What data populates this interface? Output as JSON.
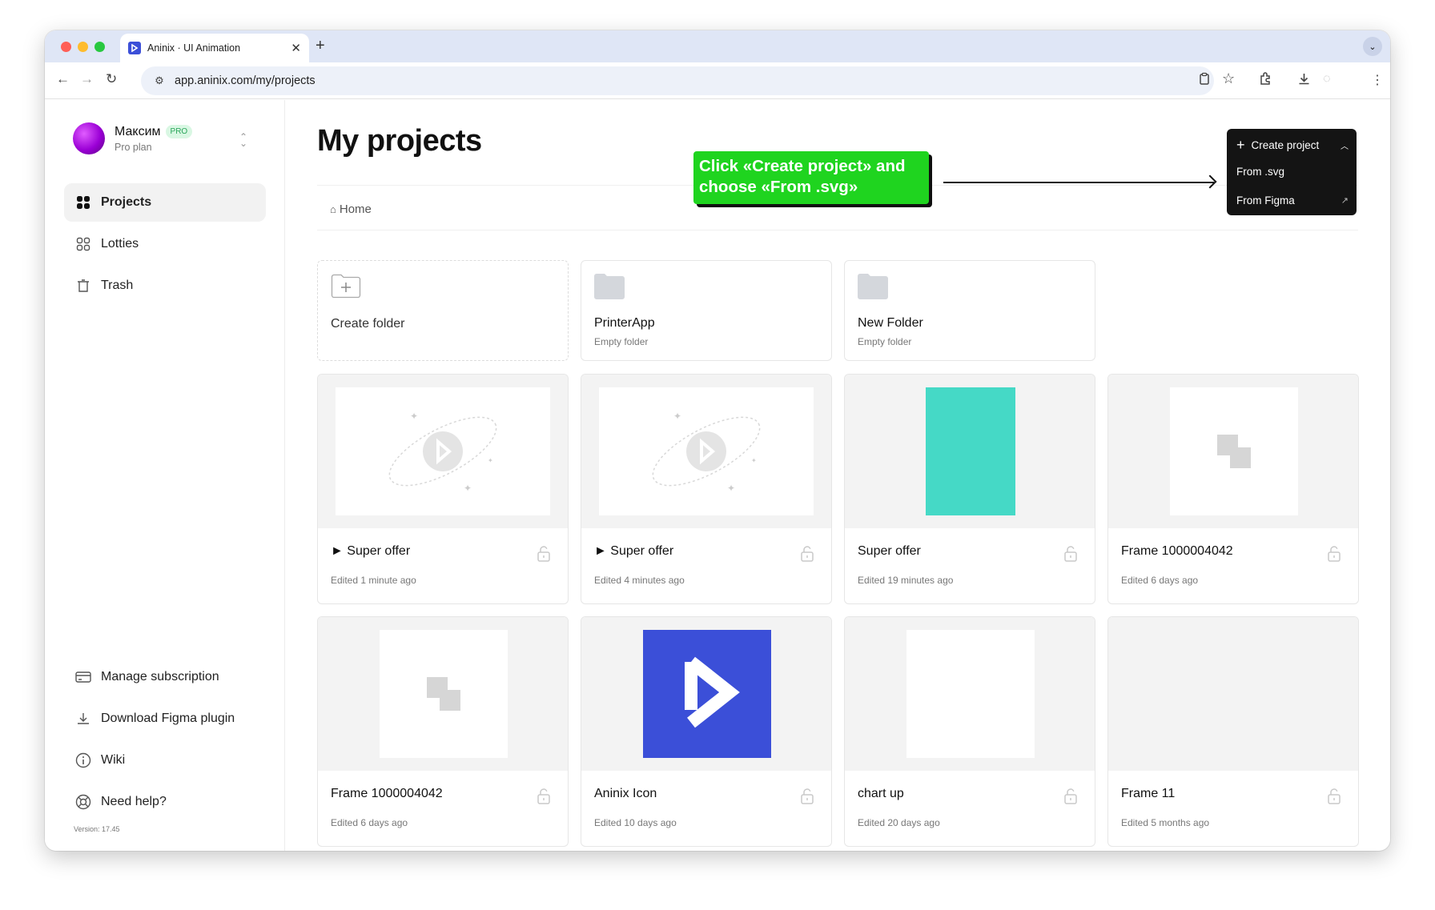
{
  "browser": {
    "tab_title": "Aninix · UI Animation",
    "tab_close": "✕",
    "new_tab": "+",
    "url": "app.aninix.com/my/projects"
  },
  "sidebar": {
    "user_name": "Максим",
    "badge": "PRO",
    "plan": "Pro plan",
    "nav": [
      {
        "label": "Projects",
        "icon": "grid-icon",
        "active": true
      },
      {
        "label": "Lotties",
        "icon": "grid-outline-icon"
      },
      {
        "label": "Trash",
        "icon": "trash-icon"
      }
    ],
    "bottom": [
      {
        "label": "Manage subscription",
        "icon": "credit-card-icon"
      },
      {
        "label": "Download Figma plugin",
        "icon": "download-icon"
      },
      {
        "label": "Wiki",
        "icon": "info-icon"
      },
      {
        "label": "Need help?",
        "icon": "lifebuoy-icon"
      }
    ],
    "version": "Version: 17.45"
  },
  "main": {
    "title": "My projects",
    "breadcrumb": "Home",
    "callout": "Click «Create project» and choose «From .svg»",
    "dropdown": {
      "create_label": "Create project",
      "items": [
        "From .svg",
        "From Figma"
      ]
    },
    "folders": [
      {
        "name": "Create folder",
        "sub": ""
      },
      {
        "name": "PrinterApp",
        "sub": "Empty folder"
      },
      {
        "name": "New Folder",
        "sub": "Empty folder"
      }
    ],
    "projects": [
      {
        "name": "► Super offer",
        "edited": "Edited 1 minute ago",
        "thumb": "placeholder-logo"
      },
      {
        "name": "► Super offer",
        "edited": "Edited 4 minutes ago",
        "thumb": "placeholder-logo"
      },
      {
        "name": "Super offer",
        "edited": "Edited 19 minutes ago",
        "thumb": "teal-rect",
        "color": "#45d9c6"
      },
      {
        "name": "Frame 1000004042",
        "edited": "Edited 6 days ago",
        "thumb": "squares"
      },
      {
        "name": "Frame 1000004042",
        "edited": "Edited 6 days ago",
        "thumb": "squares"
      },
      {
        "name": "Aninix Icon",
        "edited": "Edited 10 days ago",
        "thumb": "aninix-logo",
        "color": "#3b4fd8"
      },
      {
        "name": "chart up",
        "edited": "Edited 20 days ago",
        "thumb": "blank-white"
      },
      {
        "name": "Frame 11",
        "edited": "Edited 5 months ago",
        "thumb": "empty"
      }
    ]
  }
}
